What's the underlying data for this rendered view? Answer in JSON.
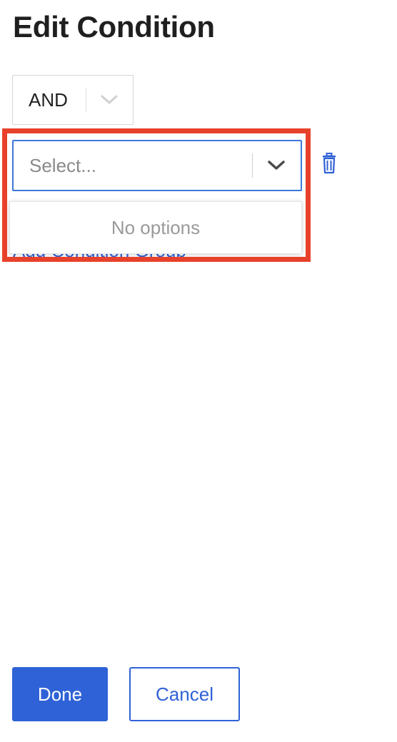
{
  "page": {
    "title": "Edit Condition"
  },
  "operator_select": {
    "value": "AND",
    "icon": "chevron-down-icon"
  },
  "field_select": {
    "placeholder": "Select...",
    "icon": "chevron-down-icon",
    "menu": {
      "empty_text": "No options"
    }
  },
  "delete_condition": {
    "icon": "trash-icon"
  },
  "add_group": {
    "label": "Add Condition Group"
  },
  "footer": {
    "done_label": "Done",
    "cancel_label": "Cancel"
  },
  "colors": {
    "accent": "#2f62d6",
    "focus_border": "#3d78d8",
    "highlight": "#e8412b"
  }
}
